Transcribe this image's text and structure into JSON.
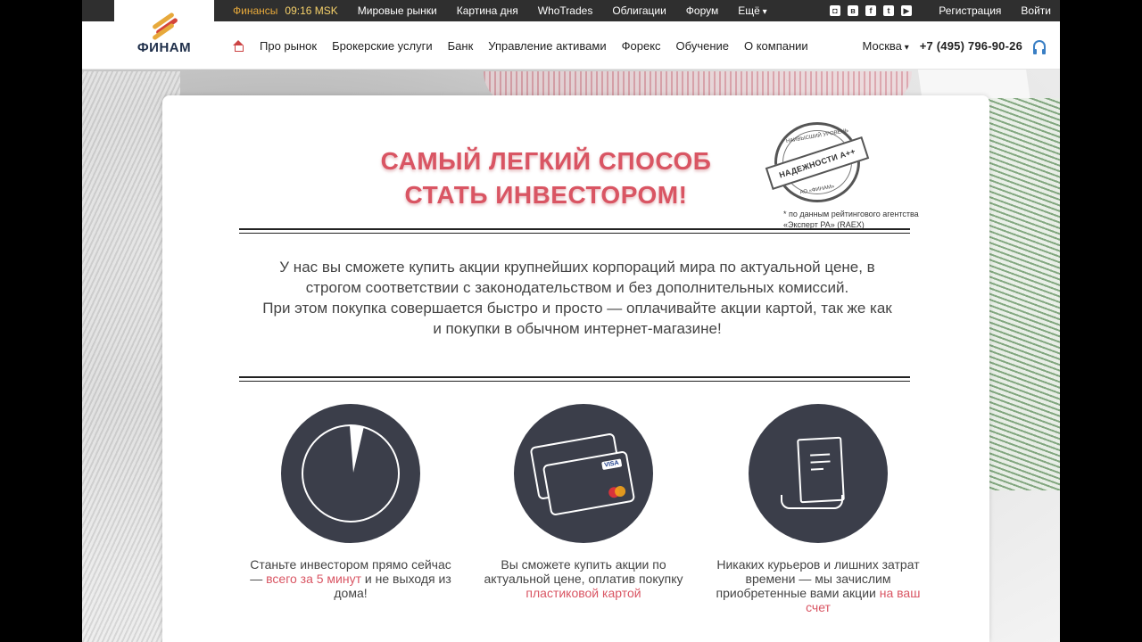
{
  "topbar": {
    "items": [
      {
        "label": "Финансы"
      },
      {
        "label": "09:16 MSK"
      },
      {
        "label": "Мировые рынки"
      },
      {
        "label": "Картина дня"
      },
      {
        "label": "WhoTrades"
      },
      {
        "label": "Облигации"
      },
      {
        "label": "Форум"
      },
      {
        "label": "Ещё"
      }
    ],
    "socials": [
      "instagram-icon",
      "vk-icon",
      "facebook-icon",
      "twitter-icon",
      "youtube-icon"
    ],
    "register": "Регистрация",
    "login": "Войти"
  },
  "logo": {
    "text": "ФИНАМ"
  },
  "nav": {
    "items": [
      {
        "label": "Про рынок"
      },
      {
        "label": "Брокерские услуги"
      },
      {
        "label": "Банк"
      },
      {
        "label": "Управление активами"
      },
      {
        "label": "Форекс"
      },
      {
        "label": "Обучение"
      },
      {
        "label": "О компании"
      }
    ],
    "city": "Москва",
    "phone": "+7 (495) 796-90-26"
  },
  "hero": {
    "line1": "САМЫЙ ЛЕГКИЙ СПОСОБ",
    "line2": "СТАТЬ ИНВЕСТОРОМ!",
    "stamp_top": "НАИВЫСШИЙ УРОВЕНЬ",
    "stamp_main": "НАДЕЖНОСТИ А++",
    "stamp_bottom": "АО «ФИНАМ»",
    "stamp_note": "* по данным рейтингового агентства «Эксперт РА» (RAEX)"
  },
  "body": {
    "paragraph1": "У нас вы сможете купить акции крупнейших корпораций мира по актуальной цене, в строгом соответствии с законодательством и без дополнительных комиссий.",
    "paragraph2": "При этом покупка совершается быстро и просто — оплачивайте акции картой, так же как и покупки в обычном интернет-магазине!"
  },
  "features": [
    {
      "pre": "Станьте инвестором прямо сейчас — ",
      "highlight": "всего за 5 минут",
      "post": " и не выходя из дома!"
    },
    {
      "pre": "Вы сможете купить акции по актуальной цене, оплатив покупку ",
      "highlight": "пластиковой картой",
      "post": ""
    },
    {
      "pre": "Никаких курьеров и лишних затрат времени — мы зачислим приобретенные вами акции ",
      "highlight": "на ваш счет",
      "post": ""
    }
  ],
  "card_labels": {
    "visa": "VISA"
  },
  "colors": {
    "accent": "#d95563",
    "topbar": "#2f2f2f",
    "circle": "#3b3e4a",
    "gold": "#e7a93b"
  }
}
